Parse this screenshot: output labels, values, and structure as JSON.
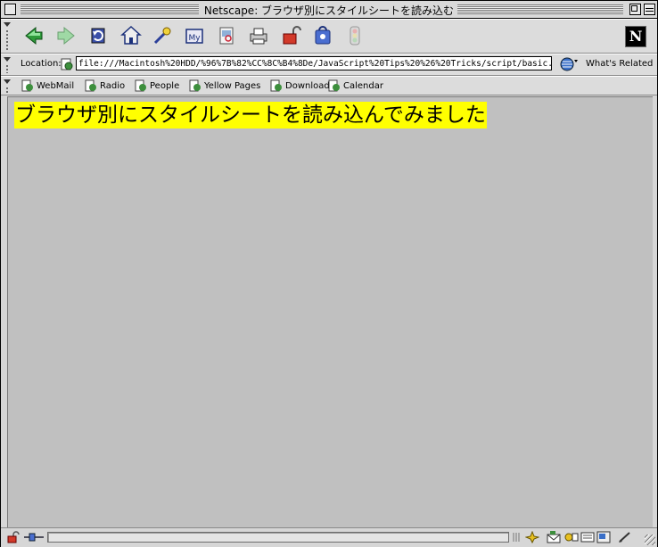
{
  "window": {
    "title": "Netscape: ブラウザ別にスタイルシートを読み込む"
  },
  "navigation_toolbar": {
    "buttons": [
      {
        "icon": "back-icon"
      },
      {
        "icon": "forward-icon"
      },
      {
        "icon": "reload-icon"
      },
      {
        "icon": "home-icon"
      },
      {
        "icon": "search-icon"
      },
      {
        "icon": "my-netscape-icon",
        "label": "My"
      },
      {
        "icon": "images-icon"
      },
      {
        "icon": "print-icon"
      },
      {
        "icon": "security-icon"
      },
      {
        "icon": "shop-icon"
      },
      {
        "icon": "stop-icon"
      }
    ],
    "logo": "N"
  },
  "location_bar": {
    "label": "Location:",
    "url": "file:///Macintosh%20HDD/%96%7B%82%CC%8C%B4%8De/JavaScript%20Tips%20%26%20Tricks/script/basic.",
    "related_label": "What's Related"
  },
  "personal_toolbar": {
    "items": [
      {
        "label": "WebMail"
      },
      {
        "label": "Radio"
      },
      {
        "label": "People"
      },
      {
        "label": "Yellow Pages"
      },
      {
        "label": "Download"
      },
      {
        "label": "Calendar"
      }
    ]
  },
  "page": {
    "heading": "ブラウザ別にスタイルシートを読み込んでみました",
    "heading_background": "#ffff00"
  },
  "status_bar": {
    "progress_fraction": 0
  },
  "colors": {
    "content_background": "#c0c0c0",
    "chrome": "#d6d6d6"
  }
}
